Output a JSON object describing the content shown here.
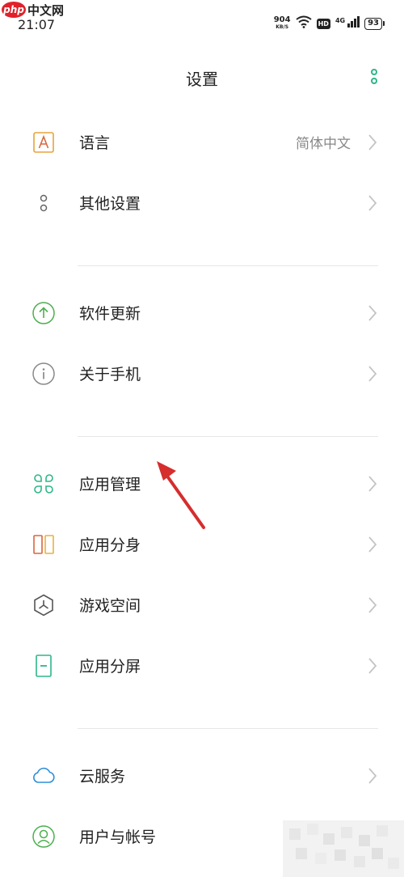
{
  "watermark": {
    "logo": "php",
    "text": "中文网"
  },
  "statusbar": {
    "time": "21:07",
    "net_speed": "904",
    "net_unit": "KB/S",
    "hd": "HD",
    "network": "4G",
    "battery": "93"
  },
  "header": {
    "title": "设置"
  },
  "sections": [
    {
      "items": [
        {
          "label": "语言",
          "value": "简体中文",
          "icon": "language-icon"
        },
        {
          "label": "其他设置",
          "value": "",
          "icon": "other-settings-icon"
        }
      ]
    },
    {
      "items": [
        {
          "label": "软件更新",
          "value": "",
          "icon": "update-icon"
        },
        {
          "label": "关于手机",
          "value": "",
          "icon": "info-icon"
        }
      ]
    },
    {
      "items": [
        {
          "label": "应用管理",
          "value": "",
          "icon": "app-management-icon"
        },
        {
          "label": "应用分身",
          "value": "",
          "icon": "app-clone-icon"
        },
        {
          "label": "游戏空间",
          "value": "",
          "icon": "game-space-icon"
        },
        {
          "label": "应用分屏",
          "value": "",
          "icon": "split-screen-icon"
        }
      ]
    },
    {
      "items": [
        {
          "label": "云服务",
          "value": "",
          "icon": "cloud-icon"
        },
        {
          "label": "用户与帐号",
          "value": "",
          "icon": "user-account-icon"
        }
      ]
    }
  ],
  "colors": {
    "accent": "#2fb58a",
    "language_icon": "#e8a33c",
    "update_icon": "#4caf50",
    "info_icon": "#888888",
    "app_management_icon": "#2fb58a",
    "app_clone_left": "#d9673e",
    "app_clone_right": "#e8b23c",
    "split_screen_icon": "#2fb58a",
    "cloud_icon": "#2f8fd8",
    "user_account_icon": "#4caf50",
    "annotation_arrow": "#d62d2d"
  }
}
